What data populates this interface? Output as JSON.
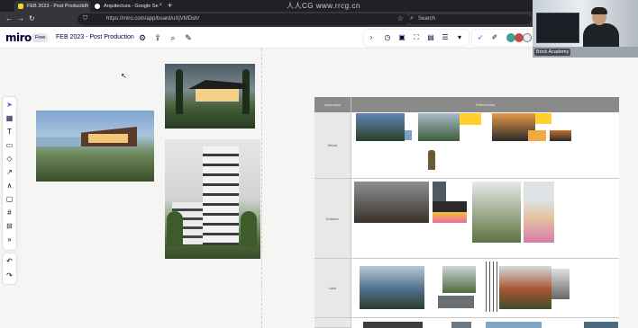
{
  "browser": {
    "tabs": [
      {
        "label": "FEB 2023 - Post Production"
      },
      {
        "label": "Arquitectura - Google Se"
      }
    ],
    "new_tab": "+",
    "watermark": "人人CG www.rrcg.cn",
    "url": "https://miro.com/app/board/uXjVMDsh/",
    "search_placeholder": "Search",
    "nav": {
      "back": "←",
      "forward": "→",
      "reload": "↻"
    }
  },
  "miro": {
    "logo": "miro",
    "plan": "Free",
    "board_title": "FEB 2023 - Post Production"
  },
  "webcam": {
    "name": "Brick Academy"
  },
  "table": {
    "header": {
      "col1": "Inspiration",
      "col2": "Referencias"
    },
    "rows": [
      {
        "label": "Mood"
      },
      {
        "label": "Exterior"
      },
      {
        "label": "Lake"
      }
    ]
  },
  "colors": {
    "miro_dark": "#050038",
    "browser_dark": "#202124",
    "table_header": "#8a8a8a"
  }
}
